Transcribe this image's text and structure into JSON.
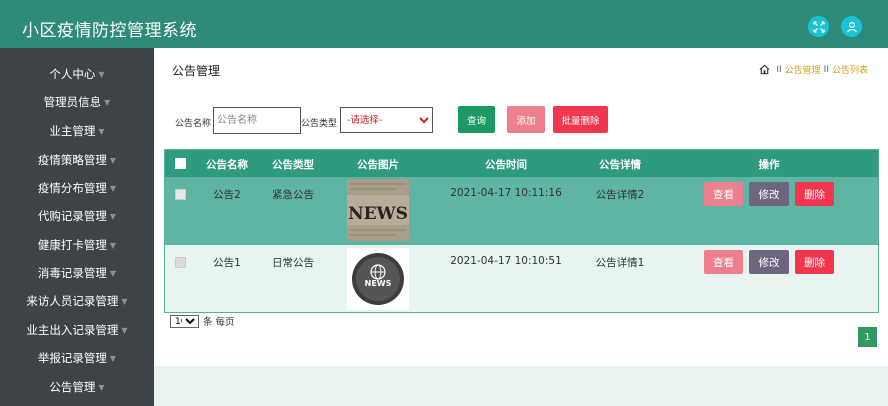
{
  "header": {
    "title": "小区疫情防控管理系统",
    "fullscreen_icon": "expand-arrows-icon",
    "user_icon": "user-icon",
    "accent": "#2e8b7a",
    "icon_bg": "#19c3d6"
  },
  "sidebar": {
    "items": [
      {
        "label": "个人中心"
      },
      {
        "label": "管理员信息"
      },
      {
        "label": "业主管理"
      },
      {
        "label": "疫情策略管理"
      },
      {
        "label": "疫情分布管理"
      },
      {
        "label": "代购记录管理"
      },
      {
        "label": "健康打卡管理"
      },
      {
        "label": "消毒记录管理"
      },
      {
        "label": "来访人员记录管理"
      },
      {
        "label": "业主出入记录管理"
      },
      {
        "label": "举报记录管理"
      },
      {
        "label": "公告管理"
      }
    ]
  },
  "page": {
    "title": "公告管理",
    "breadcrumb": {
      "home_icon": "home-icon",
      "sep": "II",
      "level1": "公告管理",
      "level2": "公告列表"
    }
  },
  "search": {
    "name_label": "公告名称",
    "name_placeholder": "公告名称",
    "name_value": "",
    "type_label": "公告类型",
    "type_selected": "-请选择-"
  },
  "actions": {
    "query": "查询",
    "add": "添加",
    "batch_delete": "批量删除"
  },
  "table": {
    "headers": [
      "公告名称",
      "公告类型",
      "公告图片",
      "公告时间",
      "公告详情",
      "操作"
    ],
    "rows": [
      {
        "name": "公告2",
        "type": "紧急公告",
        "image": "news-newspaper-image",
        "time": "2021-04-17 10:11:16",
        "detail": "公告详情2",
        "view": "查看",
        "edit": "修改",
        "delete": "删除"
      },
      {
        "name": "公告1",
        "type": "日常公告",
        "image": "news-globe-icon-image",
        "time": "2021-04-17 10:10:51",
        "detail": "公告详情1",
        "view": "查看",
        "edit": "修改",
        "delete": "删除"
      }
    ]
  },
  "pagination": {
    "page_size": "10",
    "page_size_suffix": "条 每页",
    "current_page": "1"
  }
}
